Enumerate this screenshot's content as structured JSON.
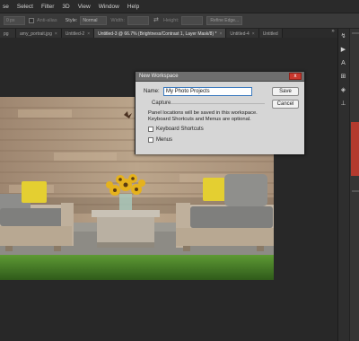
{
  "menu": [
    "se",
    "Select",
    "Filter",
    "3D",
    "View",
    "Window",
    "Help"
  ],
  "options": {
    "feather_placeholder": "0 px",
    "antialias": "Anti-alias",
    "style_label": "Style:",
    "style_value": "Normal",
    "width_label": "Width:",
    "height_label": "Height:",
    "refine_edge": "Refine Edge..."
  },
  "tabs": [
    {
      "label": "pg",
      "active": false
    },
    {
      "label": "amy_portrait.jpg",
      "active": false
    },
    {
      "label": "Untitled-2",
      "active": false
    },
    {
      "label": "Untitled-3 @ 66.7% (Brightness/Contrast 1, Layer Mask/8) *",
      "active": true
    },
    {
      "label": "Untitled-4",
      "active": false
    },
    {
      "label": "Untitled",
      "active": false
    }
  ],
  "tabs_overflow": "»",
  "dialog": {
    "title": "New Workspace",
    "name_label": "Name:",
    "name_value": "My Photo Projects",
    "save": "Save",
    "cancel": "Cancel",
    "capture": "Capture",
    "info": "Panel locations will be saved in this workspace. Keyboard Shortcuts and Menus are optional.",
    "keyboard_shortcuts": "Keyboard Shortcuts",
    "menus": "Menus",
    "close_glyph": "x"
  },
  "colors": {
    "app_bg": "#282828",
    "dialog_close": "#c9382e",
    "input_focus": "#3d7bbf",
    "lawn": "#4f8a2c"
  }
}
